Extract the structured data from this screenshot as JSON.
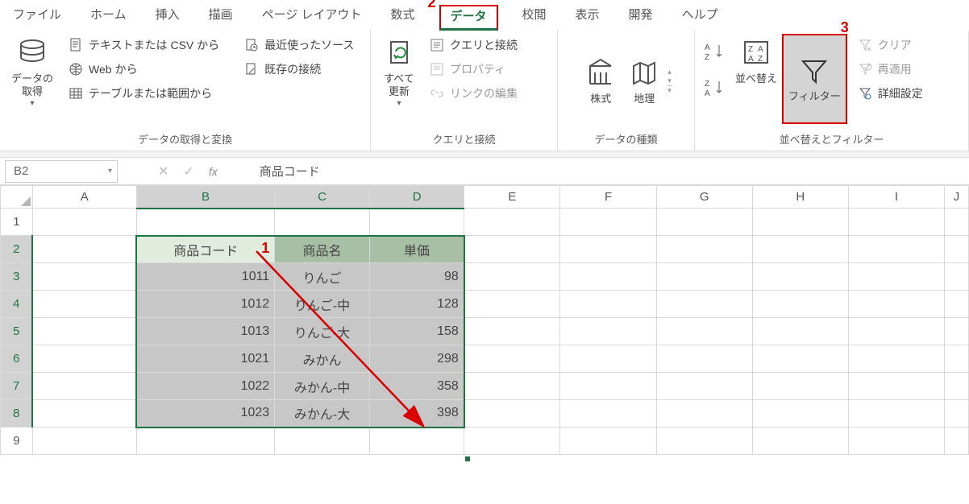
{
  "menu": {
    "file": "ファイル",
    "home": "ホーム",
    "insert": "挿入",
    "draw": "描画",
    "pagelayout": "ページ レイアウト",
    "formulas": "数式",
    "data": "データ",
    "review": "校閲",
    "view": "表示",
    "developer": "開発",
    "help": "ヘルプ"
  },
  "callouts": {
    "n1": "1",
    "n2": "2",
    "n3": "3"
  },
  "ribbon": {
    "g1": {
      "get_data": "データの\n取得",
      "from_csv": "テキストまたは CSV から",
      "from_web": "Web から",
      "from_table": "テーブルまたは範囲から",
      "recent": "最近使ったソース",
      "existing": "既存の接続",
      "label": "データの取得と変換"
    },
    "g2": {
      "refresh": "すべて\n更新",
      "queries": "クエリと接続",
      "props": "プロパティ",
      "editlinks": "リンクの編集",
      "label": "クエリと接続"
    },
    "g3": {
      "stocks": "株式",
      "geo": "地理",
      "label": "データの種類"
    },
    "g4": {
      "sort": "並べ替え",
      "filter": "フィルター",
      "clear": "クリア",
      "reapply": "再適用",
      "advanced": "詳細設定",
      "label": "並べ替えとフィルター"
    }
  },
  "formula_bar": {
    "namebox": "B2",
    "fx": "fx",
    "value": "商品コード"
  },
  "columns": [
    "A",
    "B",
    "C",
    "D",
    "E",
    "F",
    "G",
    "H",
    "I",
    "J"
  ],
  "rows": [
    "1",
    "2",
    "3",
    "4",
    "5",
    "6",
    "7",
    "8",
    "9"
  ],
  "table": {
    "headers": {
      "b": "商品コード",
      "c": "商品名",
      "d": "単価"
    },
    "r3": {
      "b": "1011",
      "c": "りんご",
      "d": "98"
    },
    "r4": {
      "b": "1012",
      "c": "りんご-中",
      "d": "128"
    },
    "r5": {
      "b": "1013",
      "c": "りんご-大",
      "d": "158"
    },
    "r6": {
      "b": "1021",
      "c": "みかん",
      "d": "298"
    },
    "r7": {
      "b": "1022",
      "c": "みかん-中",
      "d": "358"
    },
    "r8": {
      "b": "1023",
      "c": "みかん-大",
      "d": "398"
    }
  }
}
